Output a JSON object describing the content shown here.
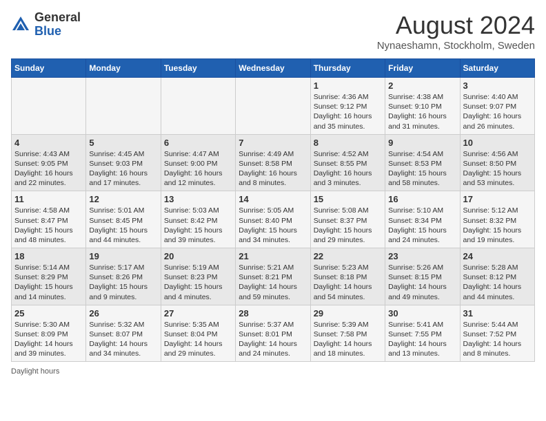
{
  "header": {
    "logo_general": "General",
    "logo_blue": "Blue",
    "month_title": "August 2024",
    "location": "Nynaeshamn, Stockholm, Sweden"
  },
  "calendar": {
    "days_of_week": [
      "Sunday",
      "Monday",
      "Tuesday",
      "Wednesday",
      "Thursday",
      "Friday",
      "Saturday"
    ],
    "weeks": [
      [
        {
          "day": "",
          "content": ""
        },
        {
          "day": "",
          "content": ""
        },
        {
          "day": "",
          "content": ""
        },
        {
          "day": "",
          "content": ""
        },
        {
          "day": "1",
          "content": "Sunrise: 4:36 AM\nSunset: 9:12 PM\nDaylight: 16 hours and 35 minutes."
        },
        {
          "day": "2",
          "content": "Sunrise: 4:38 AM\nSunset: 9:10 PM\nDaylight: 16 hours and 31 minutes."
        },
        {
          "day": "3",
          "content": "Sunrise: 4:40 AM\nSunset: 9:07 PM\nDaylight: 16 hours and 26 minutes."
        }
      ],
      [
        {
          "day": "4",
          "content": "Sunrise: 4:43 AM\nSunset: 9:05 PM\nDaylight: 16 hours and 22 minutes."
        },
        {
          "day": "5",
          "content": "Sunrise: 4:45 AM\nSunset: 9:03 PM\nDaylight: 16 hours and 17 minutes."
        },
        {
          "day": "6",
          "content": "Sunrise: 4:47 AM\nSunset: 9:00 PM\nDaylight: 16 hours and 12 minutes."
        },
        {
          "day": "7",
          "content": "Sunrise: 4:49 AM\nSunset: 8:58 PM\nDaylight: 16 hours and 8 minutes."
        },
        {
          "day": "8",
          "content": "Sunrise: 4:52 AM\nSunset: 8:55 PM\nDaylight: 16 hours and 3 minutes."
        },
        {
          "day": "9",
          "content": "Sunrise: 4:54 AM\nSunset: 8:53 PM\nDaylight: 15 hours and 58 minutes."
        },
        {
          "day": "10",
          "content": "Sunrise: 4:56 AM\nSunset: 8:50 PM\nDaylight: 15 hours and 53 minutes."
        }
      ],
      [
        {
          "day": "11",
          "content": "Sunrise: 4:58 AM\nSunset: 8:47 PM\nDaylight: 15 hours and 48 minutes."
        },
        {
          "day": "12",
          "content": "Sunrise: 5:01 AM\nSunset: 8:45 PM\nDaylight: 15 hours and 44 minutes."
        },
        {
          "day": "13",
          "content": "Sunrise: 5:03 AM\nSunset: 8:42 PM\nDaylight: 15 hours and 39 minutes."
        },
        {
          "day": "14",
          "content": "Sunrise: 5:05 AM\nSunset: 8:40 PM\nDaylight: 15 hours and 34 minutes."
        },
        {
          "day": "15",
          "content": "Sunrise: 5:08 AM\nSunset: 8:37 PM\nDaylight: 15 hours and 29 minutes."
        },
        {
          "day": "16",
          "content": "Sunrise: 5:10 AM\nSunset: 8:34 PM\nDaylight: 15 hours and 24 minutes."
        },
        {
          "day": "17",
          "content": "Sunrise: 5:12 AM\nSunset: 8:32 PM\nDaylight: 15 hours and 19 minutes."
        }
      ],
      [
        {
          "day": "18",
          "content": "Sunrise: 5:14 AM\nSunset: 8:29 PM\nDaylight: 15 hours and 14 minutes."
        },
        {
          "day": "19",
          "content": "Sunrise: 5:17 AM\nSunset: 8:26 PM\nDaylight: 15 hours and 9 minutes."
        },
        {
          "day": "20",
          "content": "Sunrise: 5:19 AM\nSunset: 8:23 PM\nDaylight: 15 hours and 4 minutes."
        },
        {
          "day": "21",
          "content": "Sunrise: 5:21 AM\nSunset: 8:21 PM\nDaylight: 14 hours and 59 minutes."
        },
        {
          "day": "22",
          "content": "Sunrise: 5:23 AM\nSunset: 8:18 PM\nDaylight: 14 hours and 54 minutes."
        },
        {
          "day": "23",
          "content": "Sunrise: 5:26 AM\nSunset: 8:15 PM\nDaylight: 14 hours and 49 minutes."
        },
        {
          "day": "24",
          "content": "Sunrise: 5:28 AM\nSunset: 8:12 PM\nDaylight: 14 hours and 44 minutes."
        }
      ],
      [
        {
          "day": "25",
          "content": "Sunrise: 5:30 AM\nSunset: 8:09 PM\nDaylight: 14 hours and 39 minutes."
        },
        {
          "day": "26",
          "content": "Sunrise: 5:32 AM\nSunset: 8:07 PM\nDaylight: 14 hours and 34 minutes."
        },
        {
          "day": "27",
          "content": "Sunrise: 5:35 AM\nSunset: 8:04 PM\nDaylight: 14 hours and 29 minutes."
        },
        {
          "day": "28",
          "content": "Sunrise: 5:37 AM\nSunset: 8:01 PM\nDaylight: 14 hours and 24 minutes."
        },
        {
          "day": "29",
          "content": "Sunrise: 5:39 AM\nSunset: 7:58 PM\nDaylight: 14 hours and 18 minutes."
        },
        {
          "day": "30",
          "content": "Sunrise: 5:41 AM\nSunset: 7:55 PM\nDaylight: 14 hours and 13 minutes."
        },
        {
          "day": "31",
          "content": "Sunrise: 5:44 AM\nSunset: 7:52 PM\nDaylight: 14 hours and 8 minutes."
        }
      ]
    ]
  },
  "footer": {
    "note": "Daylight hours"
  }
}
